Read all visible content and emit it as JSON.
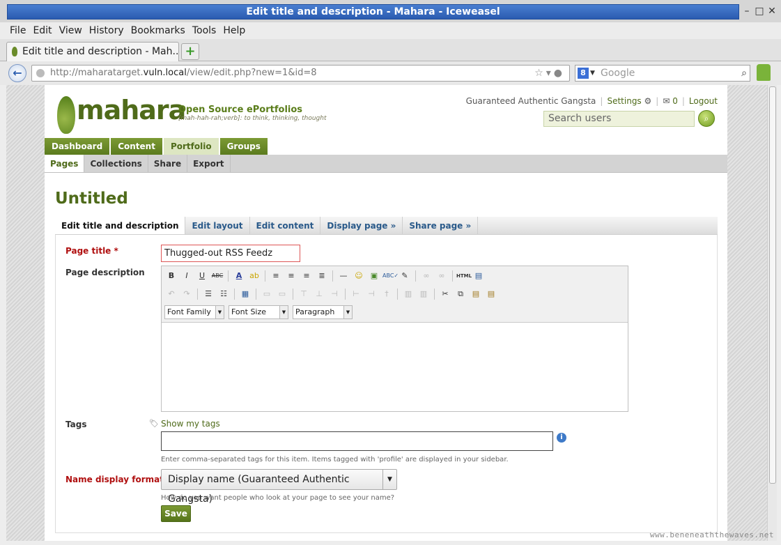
{
  "window": {
    "title": "Edit title and description - Mahara - Iceweasel"
  },
  "menubar": [
    "File",
    "Edit",
    "View",
    "History",
    "Bookmarks",
    "Tools",
    "Help"
  ],
  "browser_tab": {
    "label": "Edit title and description - Mah..."
  },
  "urlbar": {
    "prefix": "http://maharatarget.",
    "host": "vuln.local",
    "path": "/view/edit.php?new=1&id=8"
  },
  "search_engine": {
    "placeholder": "Google"
  },
  "site": {
    "logo_text": "mahara",
    "tagline": "Open Source ePortfolios",
    "tagline_sub": "[mah-hah-rah;verb]: to think, thinking, thought",
    "user_name": "Guaranteed Authentic Gangsta",
    "settings_label": "Settings",
    "messages_count": "0",
    "logout_label": "Logout",
    "search_placeholder": "Search users"
  },
  "main_nav": [
    "Dashboard",
    "Content",
    "Portfolio",
    "Groups"
  ],
  "sub_nav": [
    "Pages",
    "Collections",
    "Share",
    "Export"
  ],
  "page_heading": "Untitled",
  "edit_tabs": [
    "Edit title and description",
    "Edit layout",
    "Edit content",
    "Display page »",
    "Share page »"
  ],
  "form": {
    "page_title_label": "Page title *",
    "page_title_value": "Thugged-out RSS Feedz",
    "page_description_label": "Page description",
    "font_family": "Font Family",
    "font_size": "Font Size",
    "paragraph": "Paragraph",
    "tags_label": "Tags",
    "show_my_tags": "Show my tags",
    "tags_help": "Enter comma-separated tags for this item. Items tagged with 'profile' are displayed in your sidebar.",
    "name_display_label": "Name display format *",
    "name_display_value": "Display name (Guaranteed Authentic Gangsta)",
    "name_display_help": "How do you want people who look at your page to see your name?",
    "save_label": "Save"
  },
  "watermark": "www.beneneaththewaves.net",
  "colors": {
    "brand": "#4f6b1a",
    "nav_green": "#6b8a28",
    "required": "#b01010",
    "link": "#2a5a8a"
  }
}
